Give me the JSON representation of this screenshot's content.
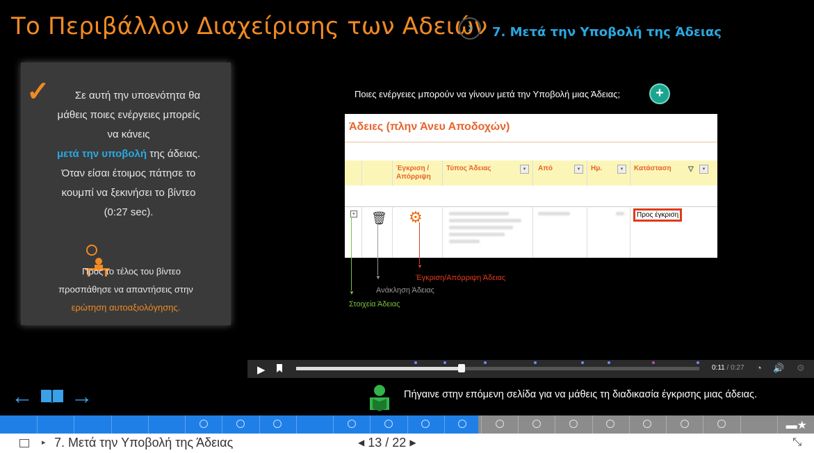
{
  "header": {
    "title": "Το Περιβάλλον Διαχείρισης των Αδειών",
    "section": "7. Μετά την Υποβολή της Άδειας",
    "next_glyph": "›"
  },
  "intro_panel": {
    "line1": "Σε αυτή την υποενότητα θα",
    "line2": "μάθεις ποιες ενέργειες μπορείς",
    "line3": "να κάνεις",
    "highlight": "μετά την υποβολή",
    "line4_rest": " της άδειας.",
    "line5": "Όταν είσαι έτοιμος πάτησε το",
    "line6": "κουμπί να ξεκινήσει το βίντεο",
    "line7": "(0:27 sec).",
    "note1": "Προς το τέλος του βίντεο",
    "note2": "προσπάθησε να απαντήσεις στην",
    "note_link": "ερώτηση αυτοαξιολόγησης."
  },
  "question": {
    "text": "Ποιες ενέργειες μπορούν να γίνουν μετά την Υποβολή μιας Άδειας;",
    "plus": "+"
  },
  "screenshot": {
    "title": "Άδειες (πλην Άνευ Αποδοχών)",
    "columns": [
      "Έγκριση / Απόρριψη",
      "Τύπος Άδειας",
      "Από",
      "Ημ.",
      "Κατάσταση"
    ],
    "status_value": "Προς έγκριση"
  },
  "annotations": {
    "approve": "Έγκριση/Απόρριψη Άδειας",
    "revoke": "Ανάκληση Άδειας",
    "details": "Στοιχεία Άδειας"
  },
  "player": {
    "current_time": "0:11",
    "separator": " / ",
    "total_time": "0:27",
    "progress": 0.41
  },
  "footer_nav": {
    "prev_glyph": "←",
    "next_glyph": "→",
    "next_page_text": "Πήγαινε στην επόμενη σελίδα για να μάθεις τη διαδικασία έγκρισης μιας άδειας."
  },
  "bottom_bar": {
    "breadcrumb": "7. Μετά την Υποβολή της Άδειας",
    "current_page": "13",
    "total_pages": "22",
    "page_sep": " / "
  },
  "colors": {
    "accent_orange": "#f08a24",
    "accent_blue": "#2aa8e0",
    "progress_blue": "#1f7fe6",
    "annot_red": "#e63a1e",
    "annot_gray": "#9a9a9a",
    "annot_green": "#7cc242"
  },
  "icons": [
    "checkmark-icon",
    "person-desk-icon",
    "plus-circle-icon",
    "gear-icon",
    "trash-icon",
    "play-icon",
    "bookmark-icon",
    "speedometer-icon",
    "volume-icon",
    "settings-icon",
    "book-icon",
    "reader-icon",
    "star-icon",
    "menu-icon",
    "collapse-icon"
  ]
}
